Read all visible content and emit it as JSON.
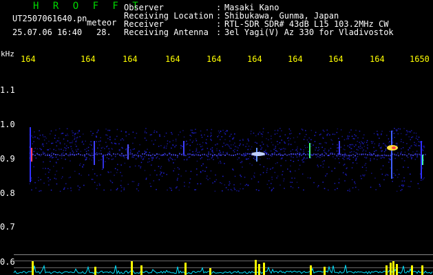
{
  "header": {
    "title": "H R O F F T",
    "filename": "UT2507061640.pn",
    "mode": "meteor",
    "datetime": "25.07.06 16:40",
    "index": "28."
  },
  "info": [
    {
      "label": "Observer",
      "value": "Masaki Kano"
    },
    {
      "label": "Receiving Location",
      "value": "Shibukawa, Gunma, Japan"
    },
    {
      "label": "Receiver",
      "value": "RTL-SDR SDR# 43dB L15 103.2MHz CW"
    },
    {
      "label": "Receiving Antenna",
      "value": "3el Yagi(V) Az 330 for Vladivostok"
    }
  ],
  "colon": ":",
  "yaxis": {
    "unit": "kHz",
    "ticks": [
      "1.1",
      "1.0",
      "0.9",
      "0.8",
      "0.7",
      "0.6"
    ]
  },
  "xaxis": {
    "ticks": [
      "164",
      "164",
      "164",
      "164",
      "164",
      "164",
      "164",
      "164",
      "164",
      "1650"
    ]
  },
  "colors": {
    "background": "#000000",
    "header_text": "#ffffff",
    "title_green": "#00d800",
    "tick_yellow": "#ffff00",
    "signal_blue": "#1a1ab4",
    "meter_cyan": "#00e0ff",
    "meter_yellow": "#ffff00"
  }
}
